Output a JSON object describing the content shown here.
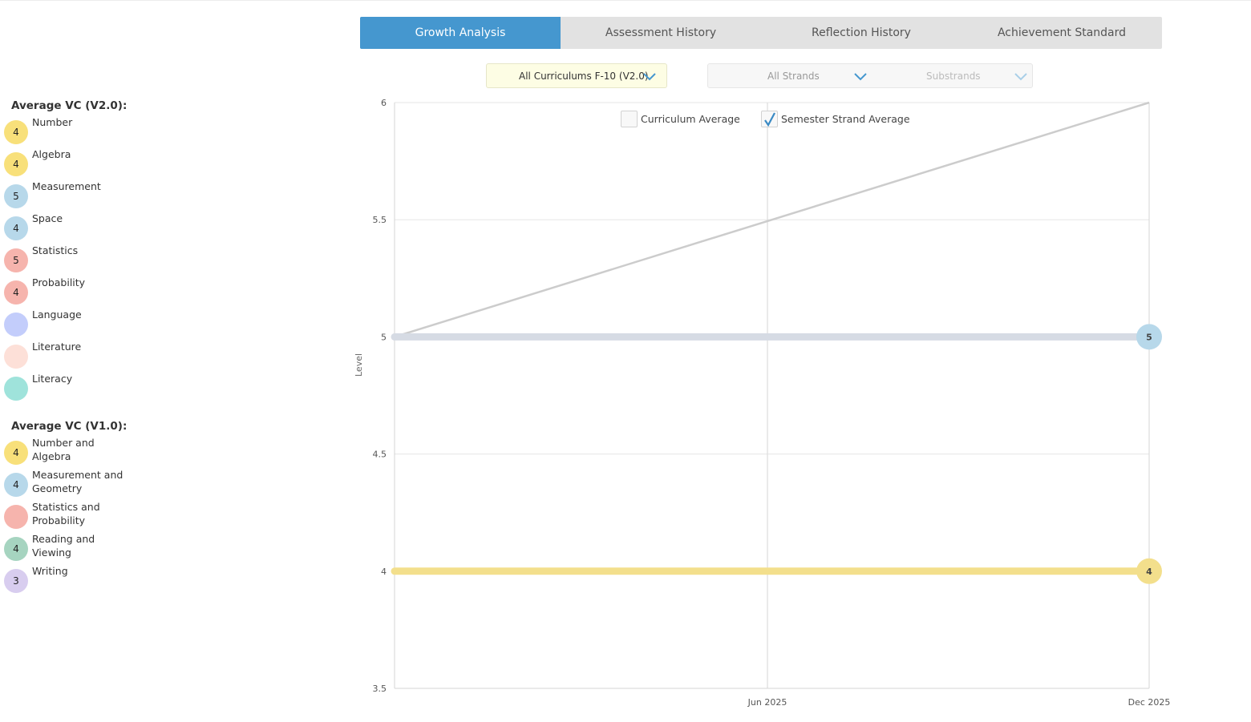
{
  "tabs": [
    {
      "label": "Growth Analysis",
      "active": true
    },
    {
      "label": "Assessment History",
      "active": false
    },
    {
      "label": "Reflection History",
      "active": false
    },
    {
      "label": "Achievement Standard",
      "active": false
    }
  ],
  "filters": {
    "curriculum": "All Curriculums F-10 (V2.0)",
    "strands": "All Strands",
    "substrands": "Substrands"
  },
  "legend": {
    "groups": [
      {
        "title": "Average VC (V2.0):",
        "items": [
          {
            "label": "Number",
            "value": "4",
            "color": "#f8e07a"
          },
          {
            "label": "Algebra",
            "value": "4",
            "color": "#f8e07a"
          },
          {
            "label": "Measurement",
            "value": "5",
            "color": "#b7d8ea"
          },
          {
            "label": "Space",
            "value": "4",
            "color": "#b7d8ea"
          },
          {
            "label": "Statistics",
            "value": "5",
            "color": "#f6b4ad"
          },
          {
            "label": "Probability",
            "value": "4",
            "color": "#f6b4ad"
          },
          {
            "label": "Language",
            "value": "",
            "color": "#c3cdfb"
          },
          {
            "label": "Literature",
            "value": "",
            "color": "#fde0d8"
          },
          {
            "label": "Literacy",
            "value": "",
            "color": "#9fe3db"
          }
        ]
      },
      {
        "title": "Average VC (V1.0):",
        "items": [
          {
            "label": "Number and Algebra",
            "value": "4",
            "color": "#f8e07a"
          },
          {
            "label": "Measurement and Geometry",
            "value": "4",
            "color": "#b7d8ea"
          },
          {
            "label": "Statistics and Probability",
            "value": "",
            "color": "#f6b4ad"
          },
          {
            "label": "Reading and Viewing",
            "value": "4",
            "color": "#a6d4c0"
          },
          {
            "label": "Writing",
            "value": "3",
            "color": "#d8cdef"
          }
        ]
      }
    ]
  },
  "toggles": {
    "curriculum_average": {
      "label": "Curriculum Average",
      "checked": false
    },
    "semester_strand_average": {
      "label": "Semester Strand Average",
      "checked": true
    }
  },
  "chart_data": {
    "type": "line",
    "ylabel": "Level",
    "xlabel": "",
    "ylim": [
      3.5,
      6
    ],
    "y_ticks": [
      "6",
      "5.5",
      "5",
      "4.5",
      "4",
      "3.5"
    ],
    "x_ticks": [
      "Jun 2025",
      "Dec 2025"
    ],
    "grid": true,
    "series": [
      {
        "points": [
          {
            "x": "Jan 2025",
            "y": 5
          },
          {
            "x": "Dec 2025",
            "y": 6
          }
        ],
        "color": "#cccccc",
        "style": "thin"
      },
      {
        "points": [
          {
            "x": "Jan 2025",
            "y": 5
          },
          {
            "x": "Dec 2025",
            "y": 5
          }
        ],
        "color": "#d6dbe4",
        "style": "thick",
        "end_label": "5",
        "end_color": "#b7d8ea"
      },
      {
        "points": [
          {
            "x": "Jan 2025",
            "y": 4
          },
          {
            "x": "Dec 2025",
            "y": 4
          }
        ],
        "color": "#f3df8c",
        "style": "thick",
        "end_label": "4",
        "end_color": "#f3df8c"
      }
    ]
  }
}
